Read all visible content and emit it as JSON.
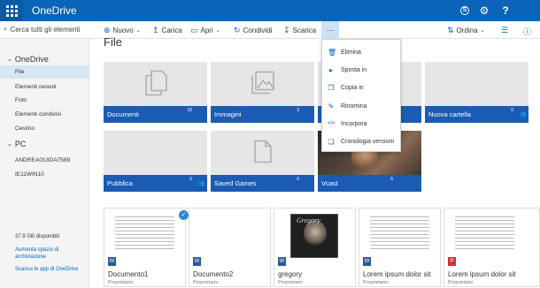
{
  "app": {
    "title": "OneDrive"
  },
  "topbar": {
    "skype_icon": "skype-icon",
    "settings_icon": "gear-icon",
    "help_icon": "help-icon"
  },
  "search": {
    "label": "Cerca tutti gli elementi"
  },
  "commands": {
    "nuovo": "Nuovo",
    "carica": "Carica",
    "apri": "Apri",
    "condividi": "Condividi",
    "scarica": "Scarica",
    "more": "···",
    "ordina": "Ordina"
  },
  "sidebar": {
    "onedrive_header": "OneDrive",
    "items": [
      "File",
      "Elementi recenti",
      "Foto",
      "Elementi condivisi",
      "Cestino"
    ],
    "pc_header": "PC",
    "pc_items": [
      "ANDREAGUIDA7589",
      "IE11WIN10"
    ],
    "storage": "37.9 GB disponibili",
    "increase_link": "Aumenta spazio di archiviazione",
    "app_link": "Scarica le app di OneDrive"
  },
  "page": {
    "title": "File"
  },
  "folders": [
    {
      "name": "Documenti",
      "count": "16"
    },
    {
      "name": "Immagini",
      "count": "3"
    },
    {
      "name": "Nuova cartella",
      "count": "0"
    },
    {
      "name": "Pubblica",
      "count": "0"
    },
    {
      "name": "Saved Games",
      "count": "0"
    },
    {
      "name": "Vcast",
      "count": "6"
    }
  ],
  "files": [
    {
      "name": "Documento1",
      "owner": "Proprietario"
    },
    {
      "name": "Documento2",
      "owner": "Proprietario"
    },
    {
      "name": "gregory",
      "owner": "Proprietario",
      "thumb_text": "Gregory"
    },
    {
      "name": "Lorem ipsum dolor sit",
      "owner": "Proprietario"
    },
    {
      "name": "Lorem ipsum dolor sit",
      "owner": "Proprietario"
    }
  ],
  "context_menu": {
    "items": [
      "Elimina",
      "Sposta in",
      "Copia in",
      "Rinomina",
      "Incorpora",
      "Cronologia versioni"
    ]
  },
  "colors": {
    "brand": "#0a64b8",
    "tile_bar": "#1a5bb4",
    "sidebar_active": "#d6e6f5"
  }
}
